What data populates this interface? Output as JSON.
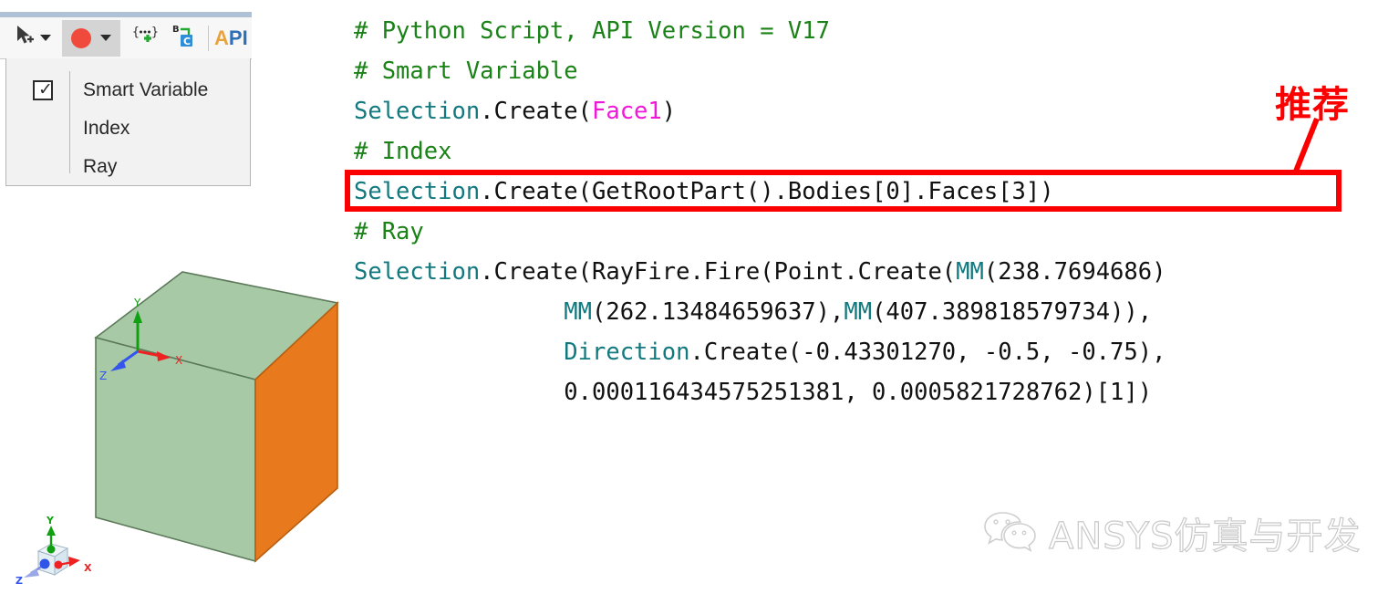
{
  "toolbar": {
    "select_icon": "cursor-plus-icon",
    "select_caret": "chevron-down-icon",
    "marker_icon": "red-dot-icon",
    "marker_caret": "chevron-down-icon",
    "variable_icon": "braces-plus-icon",
    "convert_icon": "b-to-c-icon",
    "api_label_a": "A",
    "api_label_p": "P",
    "api_label_i": "I"
  },
  "dropdown": {
    "items": [
      {
        "label": "Smart Variable",
        "checked": true,
        "check_glyph": "✓"
      },
      {
        "label": "Index",
        "checked": false,
        "check_glyph": ""
      },
      {
        "label": "Ray",
        "checked": false,
        "check_glyph": ""
      }
    ]
  },
  "code": {
    "lines": [
      {
        "id": "l1",
        "tokens": [
          {
            "t": "# Python Script, API Version = V17",
            "c": "cmt"
          }
        ]
      },
      {
        "id": "l2",
        "tokens": [
          {
            "t": "# Smart Variable",
            "c": "cmt"
          }
        ]
      },
      {
        "id": "l3",
        "tokens": [
          {
            "t": "Selection",
            "c": "cls"
          },
          {
            "t": ".Create(",
            "c": "plain"
          },
          {
            "t": "Face1",
            "c": "mag"
          },
          {
            "t": ")",
            "c": "plain"
          }
        ]
      },
      {
        "id": "l4",
        "tokens": [
          {
            "t": "# Index",
            "c": "cmt"
          }
        ]
      },
      {
        "id": "l5",
        "tokens": [
          {
            "t": "Selection",
            "c": "cls"
          },
          {
            "t": ".Create(GetRootPart().Bodies[0].Faces[3])",
            "c": "plain"
          }
        ]
      },
      {
        "id": "l6",
        "tokens": [
          {
            "t": "# Ray",
            "c": "cmt"
          }
        ]
      },
      {
        "id": "l7",
        "tokens": [
          {
            "t": "Selection",
            "c": "cls"
          },
          {
            "t": ".Create(RayFire.Fire(Point.Create(",
            "c": "plain"
          },
          {
            "t": "MM",
            "c": "cls"
          },
          {
            "t": "(238.7694686)",
            "c": "plain"
          }
        ]
      },
      {
        "id": "l8",
        "tokens": [
          {
            "t": "               ",
            "c": "plain"
          },
          {
            "t": "MM",
            "c": "cls"
          },
          {
            "t": "(262.13484659637),",
            "c": "plain"
          },
          {
            "t": "MM",
            "c": "cls"
          },
          {
            "t": "(407.389818579734)),",
            "c": "plain"
          }
        ]
      },
      {
        "id": "l9",
        "tokens": [
          {
            "t": "               ",
            "c": "plain"
          },
          {
            "t": "Direction",
            "c": "cls"
          },
          {
            "t": ".Create(-0.43301270, -0.5, -0.75),",
            "c": "plain"
          }
        ]
      },
      {
        "id": "l10",
        "tokens": [
          {
            "t": "               0.000116434575251381, 0.0005821728762)[1])",
            "c": "plain"
          }
        ]
      }
    ]
  },
  "annotation": {
    "text": "推荐",
    "color": "#fb0000",
    "highlight_box_color": "#fb0000"
  },
  "viewport": {
    "cube": {
      "top_face_color": "#a8c9a6",
      "front_face_color": "#a8c9a6",
      "right_face_color": "#e8791c",
      "edge_color": "#5c7a5a"
    },
    "origin_axes": {
      "x_label": "X",
      "y_label": "Y",
      "z_label": "Z",
      "x_color": "#ee2222",
      "y_color": "#11a011",
      "z_color": "#3355ee"
    },
    "triad": {
      "x_label": "X",
      "y_label": "Y",
      "z_label": "Z",
      "x_color": "#ee2222",
      "y_color": "#11a011",
      "z_color": "#3355ee"
    }
  },
  "watermark": {
    "icon": "wechat-icon",
    "text": "ANSYS仿真与开发"
  }
}
